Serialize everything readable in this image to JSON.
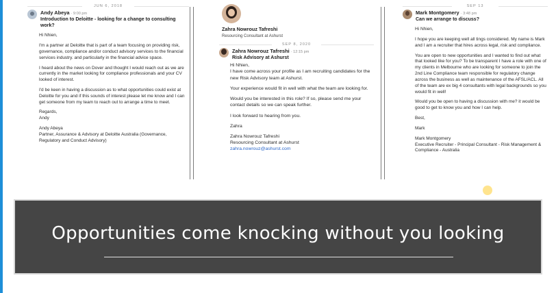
{
  "panel1": {
    "date": "JUN 6, 2018",
    "sender": "Andy Abeya",
    "time": "· 9:00 pm",
    "subject": "Introduction to Deloitte - looking for a change to consulting work?",
    "paragraphs": [
      "Hi Nhien,",
      "I'm a partner at Deloitte that is part of a team focusing on providing risk, governance, compliance and/or conduct advisory services to the financial services industry. and particularly in the financial advice space.",
      "I heard about the news on Dover and thought I would reach out as we are currently in the market looking for compliance professionals and your CV looked of interest.",
      "I'd be keen in having a discussion as to what opportunities could exist at Deloitte for you and if this sounds of interest please let me know and I can get someone from my team to reach out to arrange a time to meet.",
      "Regards,\nAndy",
      " Andy Abeya\nPartner, Assurance & Advisory at Deloitte Australia (Governance, Regulatory and Conduct Advisory)"
    ]
  },
  "panel2": {
    "profile_name": "Zahra Nowrouz Tafreshi",
    "profile_title": "Resourcing Consultant at Ashurst",
    "date": "SEP 8, 2020",
    "sender": "Zahra Nowrouz Tafreshi",
    "time": "· 12:15 pm",
    "subject": "Risk Advisory at Ashurst",
    "paragraphs": [
      "Hi Nhien,\nI have come across your profile as I am recruiting candidates for the new Risk Advisory team at Ashurst.",
      "Your experience would fit in well with what the team are looking for.",
      "Would you be interested in this role? If so, please send me your contact details so we can speak further.",
      "I look forward to hearing from you.",
      "Zahra"
    ],
    "signature": "Zahra Nowrouz Tafreshi\nResourcing Consultant at Ashurst",
    "email": "zahra.nowrouz@ashurst.com"
  },
  "panel3": {
    "date": "SEP 13",
    "sender": "Mark Montgomery",
    "time": "· 3:48 pm",
    "subject": "Can we arrange to discuss?",
    "paragraphs": [
      "Hi Nhien,",
      "I hope you are keeping well all tings considered. My name is Mark and I am a recruiter that hires across legal, risk and compliance.",
      "You are open to new opportunities and I wanted to find out what that looked like for you? To be transparent I have a role with one of my clients in Melbourne who are looking for someone to join the 2nd Line Compliance team responsible for regulatory change across the business as well as maintenance of the AFSL/ACL. All of the team are ex big 4 consultants with legal backgrounds so you would fit in well!",
      "Would you be open to having a discussion with me? it would be good to get to know you and how I can help.",
      "Best,",
      "Mark",
      "Mark Montgomery\nExecutive Recruiter - Principal Consultant - Risk Management & Compliance - Australia"
    ]
  },
  "banner": {
    "title": "Opportunities come knocking without you looking"
  },
  "colors": {
    "banner_bg": "#454545",
    "frame_accent": "#1e8fd8",
    "link": "#2a66c8"
  }
}
